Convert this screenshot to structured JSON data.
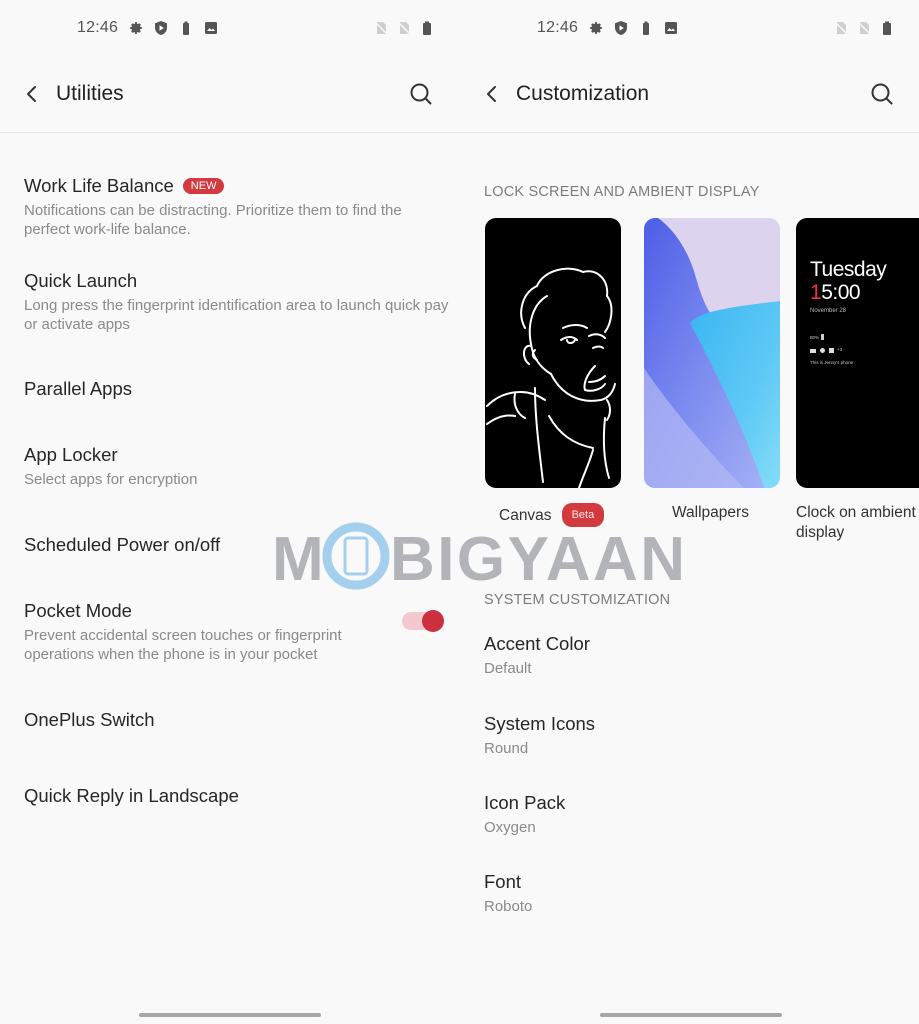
{
  "left_screen": {
    "status": {
      "time": "12:46",
      "icons": [
        "gear-icon",
        "shield-play-icon",
        "battery-saver-icon",
        "image-icon"
      ],
      "right_icons": [
        "no-sim-icon",
        "no-sim-icon",
        "battery-icon"
      ]
    },
    "title": "Utilities",
    "items": [
      {
        "title": "Work Life Balance",
        "badge": "NEW",
        "subtitle": "Notifications can be distracting. Prioritize them to find the perfect work-life balance."
      },
      {
        "title": "Quick Launch",
        "subtitle": "Long press the fingerprint identification area to launch quick pay or activate apps"
      },
      {
        "title": "Parallel Apps"
      },
      {
        "title": "App Locker",
        "subtitle": "Select apps for encryption"
      },
      {
        "title": "Scheduled Power on/off"
      },
      {
        "title": "Pocket Mode",
        "subtitle": "Prevent accidental screen touches or fingerprint operations when the phone is in your pocket",
        "toggle_on": true
      },
      {
        "title": "OnePlus Switch"
      },
      {
        "title": "Quick Reply in Landscape"
      }
    ]
  },
  "right_screen": {
    "status": {
      "time": "12:46",
      "icons": [
        "gear-icon",
        "shield-play-icon",
        "battery-saver-icon",
        "image-icon"
      ],
      "right_icons": [
        "no-sim-icon",
        "no-sim-icon",
        "battery-icon"
      ]
    },
    "title": "Customization",
    "lock_section": {
      "header": "LOCK SCREEN AND AMBIENT DISPLAY",
      "cards": [
        {
          "label": "Canvas",
          "badge": "Beta"
        },
        {
          "label": "Wallpapers"
        },
        {
          "label": "Clock on ambient display"
        }
      ],
      "ambient_preview": {
        "day": "Tuesday",
        "time_accent": "1",
        "time_rest": "5:00",
        "date": "November 28",
        "battery": "80%",
        "notif_more": "+3",
        "owner": "This is Jenny's phone"
      }
    },
    "system_section": {
      "header": "SYSTEM CUSTOMIZATION",
      "items": [
        {
          "title": "Accent Color",
          "value": "Default"
        },
        {
          "title": "System Icons",
          "value": "Round"
        },
        {
          "title": "Icon Pack",
          "value": "Oxygen"
        },
        {
          "title": "Font",
          "value": "Roboto"
        }
      ]
    }
  },
  "watermark": {
    "prefix": "M",
    "rest": "BIGYAAN"
  },
  "colors": {
    "accent": "#d23a3f",
    "toggle_track": "#f3c9cf",
    "toggle_thumb": "#cc2f3d",
    "background": "#f9f9f9"
  }
}
